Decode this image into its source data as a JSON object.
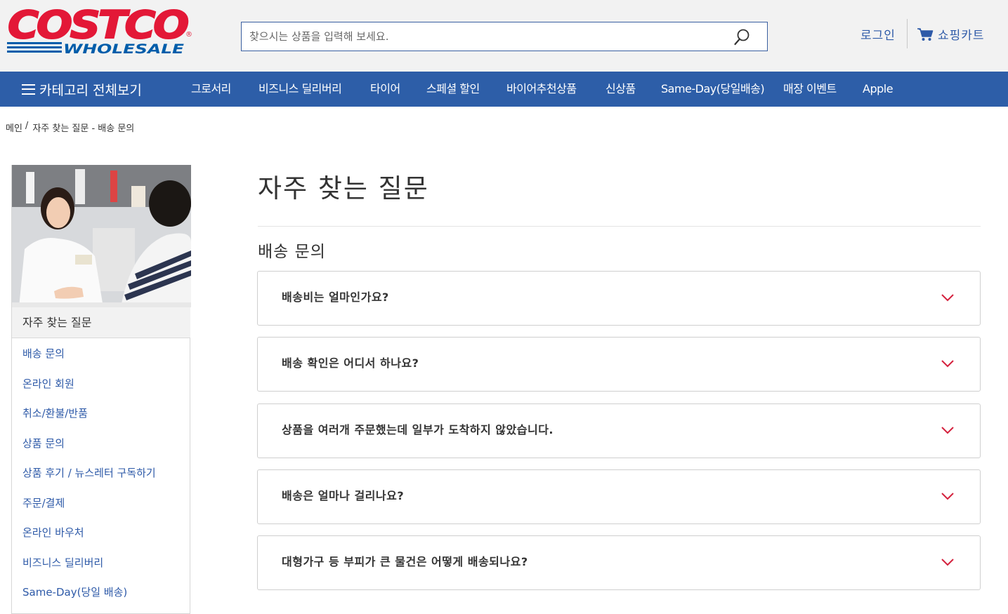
{
  "header": {
    "logo": {
      "line1": "COSTCO",
      "line2": "WHOLESALE",
      "reg": "®"
    },
    "search": {
      "placeholder": "찾으시는 상품을 입력해 보세요.",
      "value": ""
    },
    "login_label": "로그인",
    "cart_label": "쇼핑카트"
  },
  "nav": {
    "all_categories": "카테고리 전체보기",
    "items": [
      "그로서리",
      "비즈니스 딜리버리",
      "타이어",
      "스페셜 할인",
      "바이어추천상품",
      "신상품",
      "Same-Day(당일배송)",
      "매장 이벤트",
      "Apple"
    ]
  },
  "breadcrumb": {
    "home": "메인",
    "separator": "/",
    "current": "자주 찾는 질문 - 배송 문의"
  },
  "sidebar": {
    "heading": "자주 찾는 질문",
    "links": [
      "배송 문의",
      "온라인 회원",
      "취소/환불/반품",
      "상품 문의",
      "상품 후기 / 뉴스레터 구독하기",
      "주문/결제",
      "온라인 바우처",
      "비즈니스 딜리버리",
      "Same-Day(당일 배송)"
    ]
  },
  "main": {
    "title": "자주 찾는 질문",
    "section_title": "배송 문의",
    "faqs": [
      "배송비는 얼마인가요?",
      "배송 확인은 어디서 하나요?",
      "상품을 여러개 주문했는데 일부가 도착하지 않았습니다.",
      "배송은 얼마나 걸리나요?",
      "대형가구 등 부피가 큰 물건은 어떻게 배송되나요?"
    ]
  },
  "colors": {
    "brand_red": "#e31837",
    "brand_blue": "#005daa",
    "nav_blue": "#2d5ea8",
    "link_blue": "#2e5aa8",
    "chevron_red": "#d4213d"
  },
  "icons": {
    "search": "search-icon",
    "cart": "cart-icon",
    "menu": "hamburger-icon",
    "faq_toggle": "chevron-down-icon"
  }
}
